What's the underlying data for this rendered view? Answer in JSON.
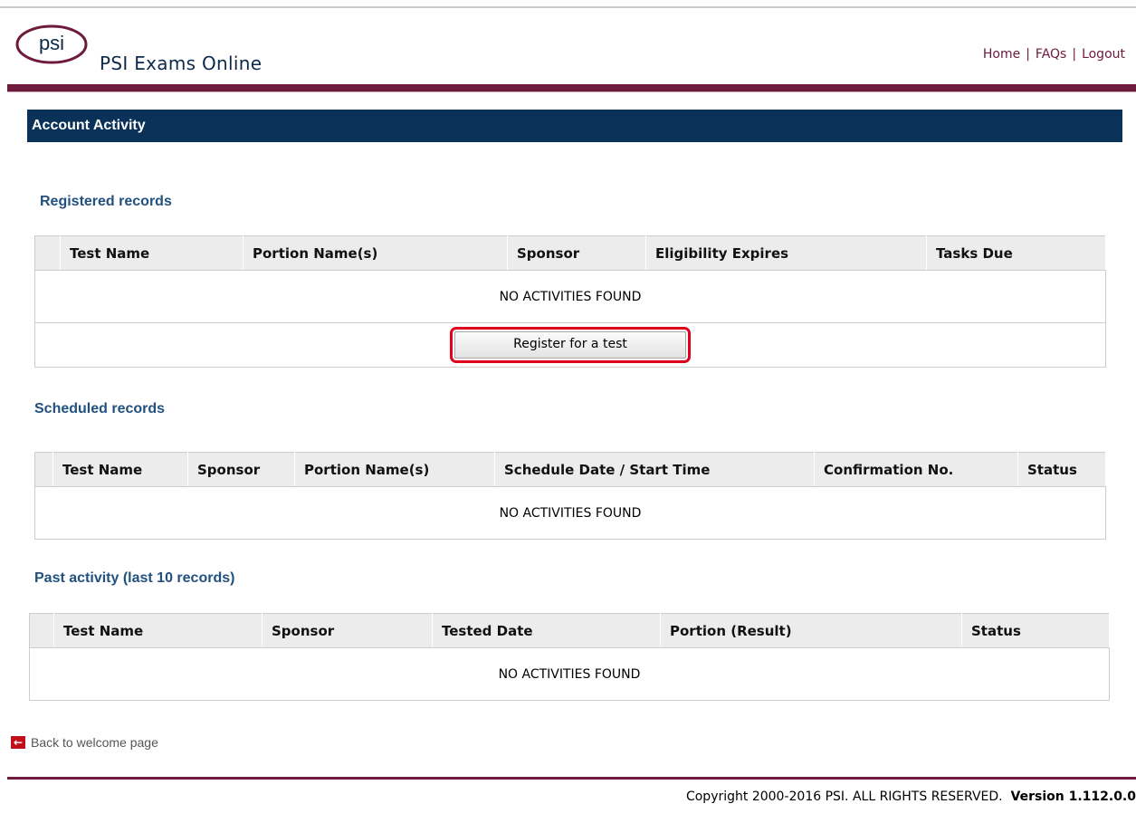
{
  "header": {
    "logo_text": "psi",
    "app_title": "PSI Exams Online",
    "links": [
      "Home",
      "FAQs",
      "Logout"
    ],
    "link_separator": "|"
  },
  "page_title": "Account Activity",
  "registered": {
    "heading": "Registered records",
    "columns": [
      "Test Name",
      "Portion Name(s)",
      "Sponsor",
      "Eligibility Expires",
      "Tasks Due"
    ],
    "empty_text": "NO ACTIVITIES FOUND",
    "register_button": "Register for a test"
  },
  "scheduled": {
    "heading": "Scheduled records",
    "columns": [
      "Test Name",
      "Sponsor",
      "Portion Name(s)",
      "Schedule Date / Start Time",
      "Confirmation No.",
      "Status"
    ],
    "empty_text": "NO ACTIVITIES FOUND"
  },
  "past": {
    "heading": "Past activity (last 10 records)",
    "columns": [
      "Test Name",
      "Sponsor",
      "Tested Date",
      "Portion (Result)",
      "Status"
    ],
    "empty_text": "NO ACTIVITIES FOUND"
  },
  "back_link": {
    "icon": "back-arrow-icon",
    "label": "Back to welcome page"
  },
  "footer": {
    "copyright": "Copyright 2000-2016 PSI. ALL RIGHTS RESERVED.",
    "version": "Version 1.112.0.0"
  },
  "colors": {
    "maroon": "#6d1a3c",
    "navy": "#0a3158",
    "heading_blue": "#21517f",
    "highlight_red": "#e0001b"
  }
}
